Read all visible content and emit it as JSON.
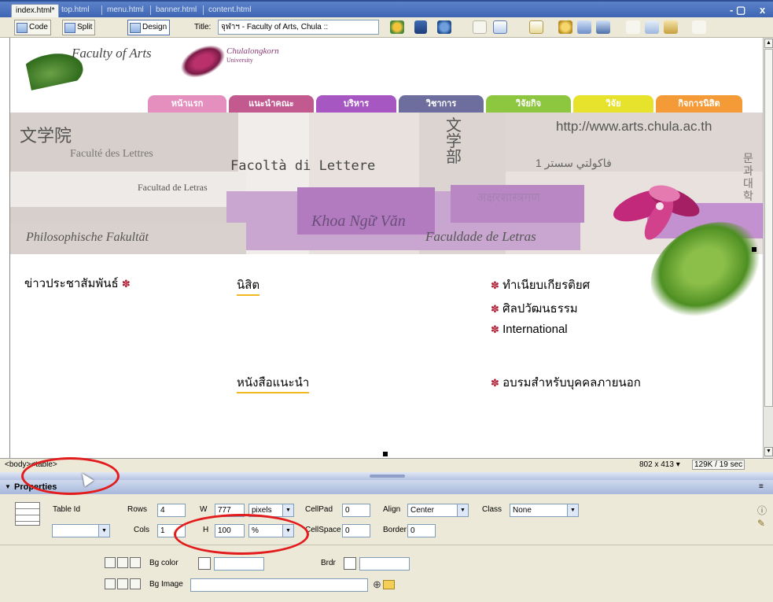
{
  "doc_tabs": [
    {
      "label": "index.html*",
      "active": true
    },
    {
      "label": "top.html",
      "active": false
    },
    {
      "label": "menu.html",
      "active": false
    },
    {
      "label": "banner.html",
      "active": false
    },
    {
      "label": "content.html",
      "active": false
    }
  ],
  "window_controls": {
    "restore": "- ♂",
    "close": "x"
  },
  "toolbar": {
    "code_label": "Code",
    "split_label": "Split",
    "design_label": "Design",
    "title_label": "Title:",
    "title_value": "จุฬาฯ - Faculty of Arts, Chula ::"
  },
  "page": {
    "logo_text": "Faculty of Arts",
    "chula_line1": "Chulalongkorn",
    "chula_line2": "University",
    "nav_items": [
      "หน้าแรก",
      "แนะนำคณะ",
      "บริหาร",
      "วิชาการ",
      "วิจัยกิจ",
      "วิจัย",
      "กิจการนิสิต"
    ],
    "nav_colors": [
      "#e58fbf",
      "#c35a8f",
      "#a757c2",
      "#6d6e9d",
      "#8dc63f",
      "#e7e32d",
      "#f49a37"
    ],
    "banner_texts": {
      "chinese": "文学院",
      "french": "Faculté des Lettres",
      "italian": "Facoltà di Lettere",
      "japanese": "文学部",
      "url": "http://www.arts.chula.ac.th",
      "arabic": "فاكولتي سستر 1",
      "spanish": "Facultad de Letras",
      "hindi": "अक्षरशास्त्रगण",
      "vietnamese": "Khoa Ngữ Văn",
      "german": "Philosophische Fakultät",
      "portuguese": "Faculdade de Letras",
      "korean": "문 과 대 학"
    },
    "content": {
      "pr_news": "ข่าวประชาสัมพันธ์",
      "students": "นิสิต",
      "books": "หนังสือแนะนำ",
      "honors": "ทำเนียบเกียรติยศ",
      "culture": "ศิลปวัฒนธรรม",
      "international": "International",
      "training": "อบรมสำหรับบุคคลภายนอก"
    }
  },
  "statusbar": {
    "tag_body": "<body>",
    "tag_table": "<table>",
    "window_size": "802 x 413",
    "download": "129K / 19 sec"
  },
  "properties": {
    "title": "Properties",
    "table_id_label": "Table Id",
    "table_id_value": "",
    "rows_label": "Rows",
    "rows_value": "4",
    "w_label": "W",
    "w_value": "777",
    "w_unit": "pixels",
    "cols_label": "Cols",
    "cols_value": "1",
    "h_label": "H",
    "h_value": "100",
    "h_unit": "%",
    "cellpad_label": "CellPad",
    "cellpad_value": "0",
    "cellspace_label": "CellSpace",
    "cellspace_value": "0",
    "align_label": "Align",
    "align_value": "Center",
    "border_label": "Border",
    "border_value": "0",
    "class_label": "Class",
    "class_value": "None",
    "bgcolor_label": "Bg color",
    "brdr_label": "Brdr",
    "bgimage_label": "Bg Image",
    "bgimage_value": ""
  }
}
